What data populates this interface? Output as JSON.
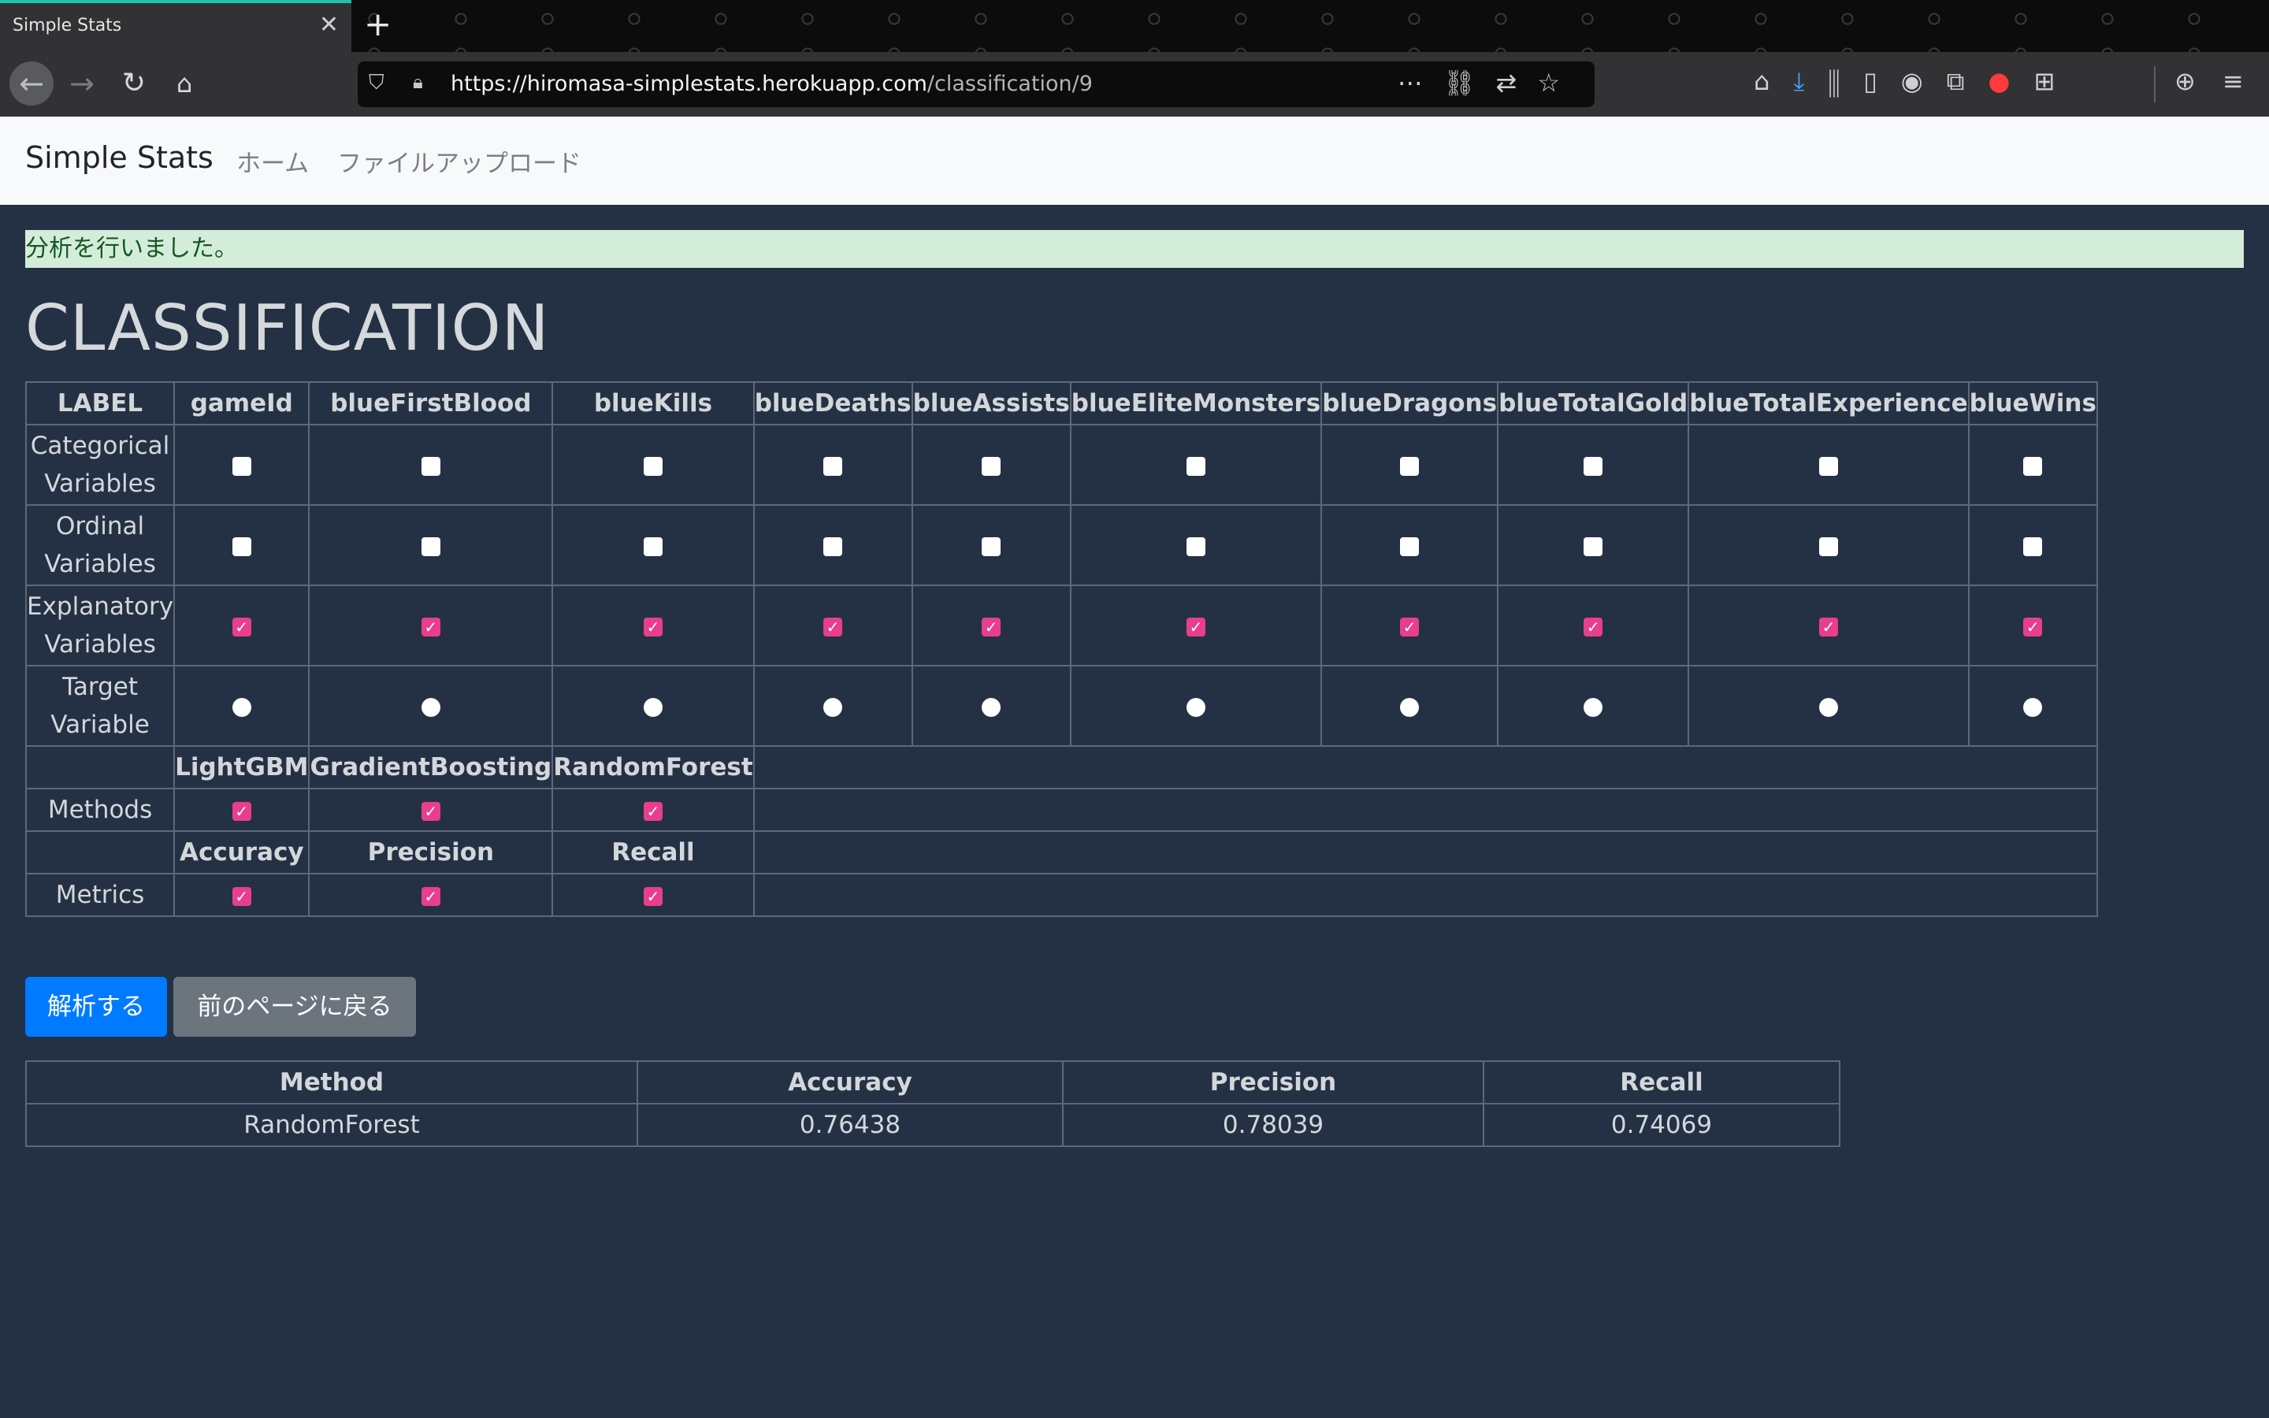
{
  "browser": {
    "tab_title": "Simple Stats",
    "url_host": "https://hiromasa-simplestats.herokuapp.com",
    "url_path": "/classification/9"
  },
  "navbar": {
    "brand": "Simple Stats",
    "links": [
      "ホーム",
      "ファイルアップロード"
    ]
  },
  "alert": "分析を行いました。",
  "title": "CLASSIFICATION",
  "config_table": {
    "label_header": "LABEL",
    "columns": [
      "gameId",
      "blueFirstBlood",
      "blueKills",
      "blueDeaths",
      "blueAssists",
      "blueEliteMonsters",
      "blueDragons",
      "blueTotalGold",
      "blueTotalExperience",
      "blueWins"
    ],
    "rows": {
      "categorical": "Categorical Variables",
      "ordinal": "Ordinal Variables",
      "explanatory": "Explanatory Variables",
      "target": "Target Variable"
    },
    "checked": {
      "categorical": [
        false,
        false,
        false,
        false,
        false,
        false,
        false,
        false,
        false,
        false
      ],
      "ordinal": [
        false,
        false,
        false,
        false,
        false,
        false,
        false,
        false,
        false,
        false
      ],
      "explanatory": [
        true,
        true,
        true,
        true,
        true,
        true,
        true,
        true,
        true,
        true
      ],
      "target": [
        false,
        false,
        false,
        false,
        false,
        false,
        false,
        false,
        false,
        false
      ]
    },
    "methods_label": "Methods",
    "methods": [
      "LightGBM",
      "GradientBoosting",
      "RandomForest"
    ],
    "methods_checked": [
      true,
      true,
      true
    ],
    "metrics_label": "Metrics",
    "metrics": [
      "Accuracy",
      "Precision",
      "Recall"
    ],
    "metrics_checked": [
      true,
      true,
      true
    ]
  },
  "buttons": {
    "analyze": "解析する",
    "back": "前のページに戻る"
  },
  "results": {
    "headers": [
      "Method",
      "Accuracy",
      "Precision",
      "Recall"
    ],
    "rows": [
      [
        "RandomForest",
        "0.76438",
        "0.78039",
        "0.74069"
      ]
    ]
  },
  "colors": {
    "page_bg": "#243145",
    "check_on": "#e83e8c",
    "primary": "#007bff",
    "secondary": "#6c757d",
    "alert_bg": "#d4edda"
  }
}
